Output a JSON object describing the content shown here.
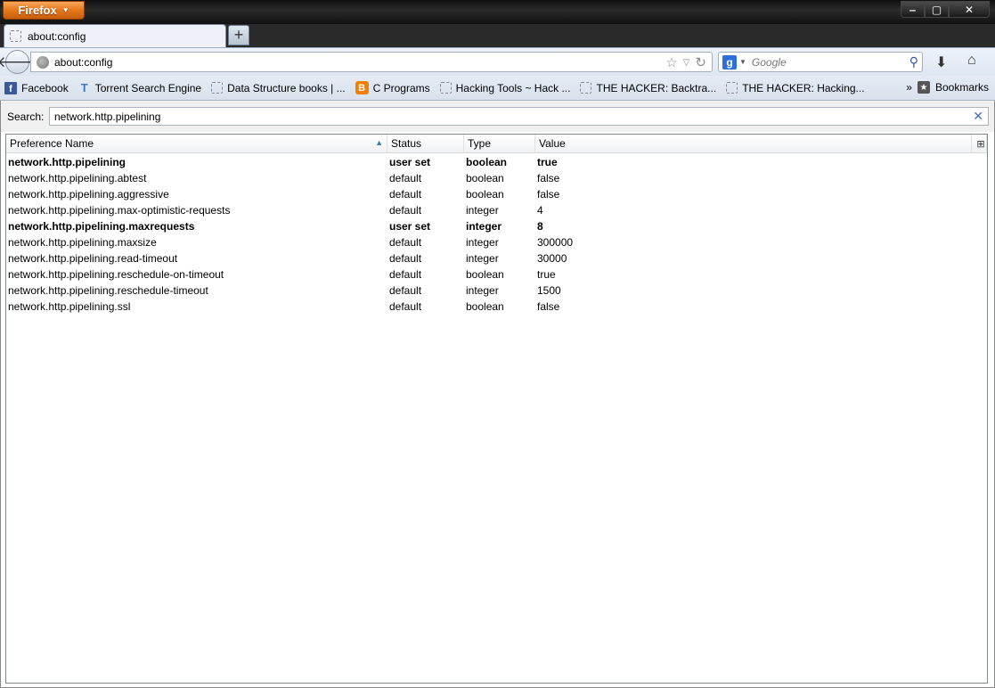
{
  "window": {
    "menu_button": "Firefox",
    "minimize": "‒",
    "maximize": "▢",
    "close": "✕"
  },
  "tab": {
    "title": "about:config",
    "new_tab": "+"
  },
  "nav": {
    "url": "about:config",
    "search_placeholder": "Google"
  },
  "bookmarks": {
    "items": [
      "Facebook",
      "Torrent Search Engine",
      "Data Structure books | ...",
      "C Programs",
      "Hacking Tools ~ Hack ...",
      "THE HACKER: Backtra...",
      "THE HACKER: Hacking..."
    ],
    "overflow": "»",
    "menu": "Bookmarks"
  },
  "config": {
    "search_label": "Search:",
    "filter_value": "network.http.pipelining",
    "columns": [
      "Preference Name",
      "Status",
      "Type",
      "Value"
    ],
    "rows": [
      {
        "name": "network.http.pipelining",
        "status": "user set",
        "type": "boolean",
        "value": "true",
        "modified": true
      },
      {
        "name": "network.http.pipelining.abtest",
        "status": "default",
        "type": "boolean",
        "value": "false",
        "modified": false
      },
      {
        "name": "network.http.pipelining.aggressive",
        "status": "default",
        "type": "boolean",
        "value": "false",
        "modified": false
      },
      {
        "name": "network.http.pipelining.max-optimistic-requests",
        "status": "default",
        "type": "integer",
        "value": "4",
        "modified": false
      },
      {
        "name": "network.http.pipelining.maxrequests",
        "status": "user set",
        "type": "integer",
        "value": "8",
        "modified": true
      },
      {
        "name": "network.http.pipelining.maxsize",
        "status": "default",
        "type": "integer",
        "value": "300000",
        "modified": false
      },
      {
        "name": "network.http.pipelining.read-timeout",
        "status": "default",
        "type": "integer",
        "value": "30000",
        "modified": false
      },
      {
        "name": "network.http.pipelining.reschedule-on-timeout",
        "status": "default",
        "type": "boolean",
        "value": "true",
        "modified": false
      },
      {
        "name": "network.http.pipelining.reschedule-timeout",
        "status": "default",
        "type": "integer",
        "value": "1500",
        "modified": false
      },
      {
        "name": "network.http.pipelining.ssl",
        "status": "default",
        "type": "boolean",
        "value": "false",
        "modified": false
      }
    ]
  }
}
